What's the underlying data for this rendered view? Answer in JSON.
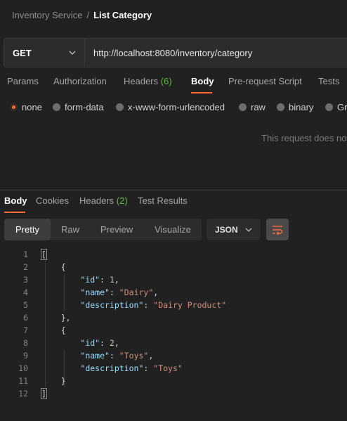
{
  "breadcrumb": {
    "parent": "Inventory Service",
    "separator": "/",
    "current": "List Category"
  },
  "request": {
    "method": "GET",
    "url": "http://localhost:8080/inventory/category"
  },
  "request_tabs": [
    {
      "label": "Params",
      "count": ""
    },
    {
      "label": "Authorization",
      "count": ""
    },
    {
      "label": "Headers",
      "count": "(6)"
    },
    {
      "label": "Body",
      "count": ""
    },
    {
      "label": "Pre-request Script",
      "count": ""
    },
    {
      "label": "Tests",
      "count": ""
    }
  ],
  "request_tabs_active": "Body",
  "body_types": [
    "none",
    "form-data",
    "x-www-form-urlencoded",
    "raw",
    "binary",
    "Gr"
  ],
  "body_type_selected": "none",
  "no_body_message": "This request does not",
  "response_tabs": [
    {
      "label": "Body",
      "count": ""
    },
    {
      "label": "Cookies",
      "count": ""
    },
    {
      "label": "Headers",
      "count": "(2)"
    },
    {
      "label": "Test Results",
      "count": ""
    }
  ],
  "response_tabs_active": "Body",
  "view_modes": [
    "Pretty",
    "Raw",
    "Preview",
    "Visualize"
  ],
  "view_mode_selected": "Pretty",
  "format": "JSON",
  "code_lines": [
    {
      "n": "1",
      "text": "["
    },
    {
      "n": "2",
      "text": "    {"
    },
    {
      "n": "3",
      "text": "        \"id\": 1,"
    },
    {
      "n": "4",
      "text": "        \"name\": \"Dairy\","
    },
    {
      "n": "5",
      "text": "        \"description\": \"Dairy Product\""
    },
    {
      "n": "6",
      "text": "    },"
    },
    {
      "n": "7",
      "text": "    {"
    },
    {
      "n": "8",
      "text": "        \"id\": 2,"
    },
    {
      "n": "9",
      "text": "        \"name\": \"Toys\","
    },
    {
      "n": "10",
      "text": "        \"description\": \"Toys\""
    },
    {
      "n": "11",
      "text": "    }"
    },
    {
      "n": "12",
      "text": "]"
    }
  ],
  "colors": {
    "accent": "#ff6c37",
    "count": "#5fb84d",
    "json_key": "#9cdcfe",
    "json_string": "#ce9178",
    "json_number": "#b5cea8"
  },
  "icons": {
    "method_dropdown": "chevron-down-icon",
    "format_dropdown": "chevron-down-icon",
    "wrap": "wrap-lines-icon"
  }
}
